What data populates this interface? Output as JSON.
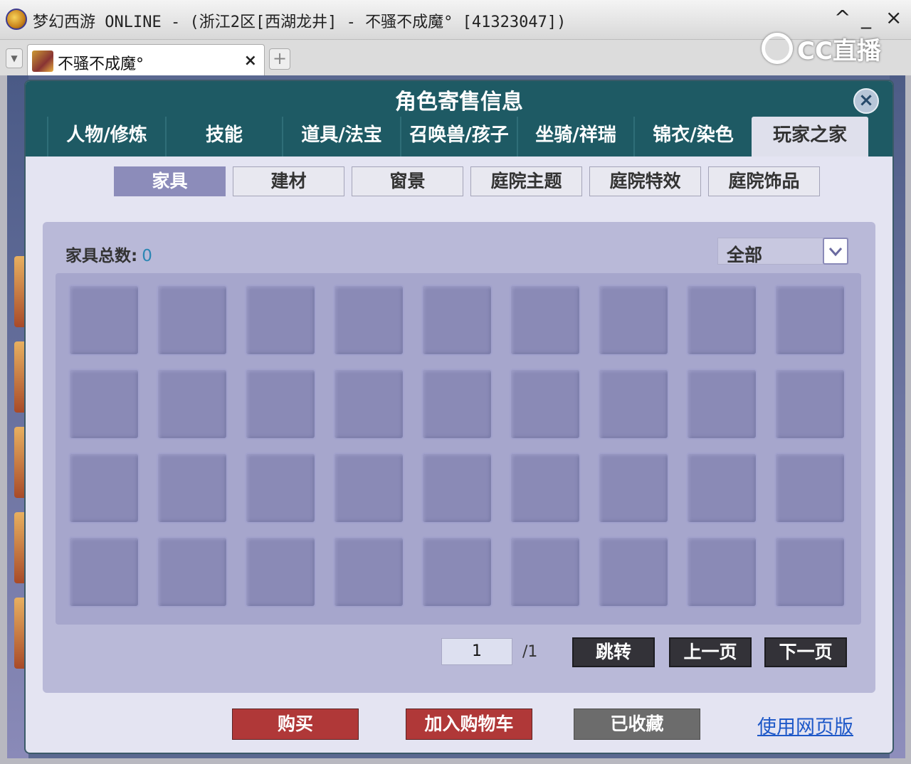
{
  "window": {
    "title": "梦幻西游 ONLINE - (浙江2区[西湖龙井] - 不骚不成魔° [41323047])",
    "controls": {
      "collapse": "^",
      "minimize": "_",
      "close": "×"
    }
  },
  "watermark": {
    "text": "CC直播"
  },
  "browser_tab": {
    "label": "不骚不成魔°",
    "close": "×",
    "new_tab": "+"
  },
  "dialog": {
    "title": "角色寄售信息",
    "close_symbol": "×",
    "main_tabs": [
      {
        "label": "人物/修炼",
        "active": false
      },
      {
        "label": "技能",
        "active": false
      },
      {
        "label": "道具/法宝",
        "active": false
      },
      {
        "label": "召唤兽/孩子",
        "active": false
      },
      {
        "label": "坐骑/祥瑞",
        "active": false
      },
      {
        "label": "锦衣/染色",
        "active": false
      },
      {
        "label": "玩家之家",
        "active": true
      }
    ],
    "sub_tabs": [
      {
        "label": "家具",
        "active": true
      },
      {
        "label": "建材",
        "active": false
      },
      {
        "label": "窗景",
        "active": false
      },
      {
        "label": "庭院主题",
        "active": false
      },
      {
        "label": "庭院特效",
        "active": false
      },
      {
        "label": "庭院饰品",
        "active": false
      }
    ],
    "count_label": "家具总数:",
    "count_value": "0",
    "filter": {
      "selected": "全部"
    },
    "grid": {
      "columns": 9,
      "rows": 4,
      "filled": 0
    },
    "pager": {
      "current_page": "1",
      "total": "/1",
      "jump": "跳转",
      "prev": "上一页",
      "next": "下一页"
    },
    "actions": {
      "buy": "购买",
      "add_to_cart": "加入购物车",
      "saved": "已收藏",
      "web_link": "使用网页版"
    }
  },
  "colors": {
    "header_teal": "#1e5a64",
    "active_subtab": "#8c8cba",
    "buy_red": "#b03838",
    "link_blue": "#1e58c8"
  }
}
